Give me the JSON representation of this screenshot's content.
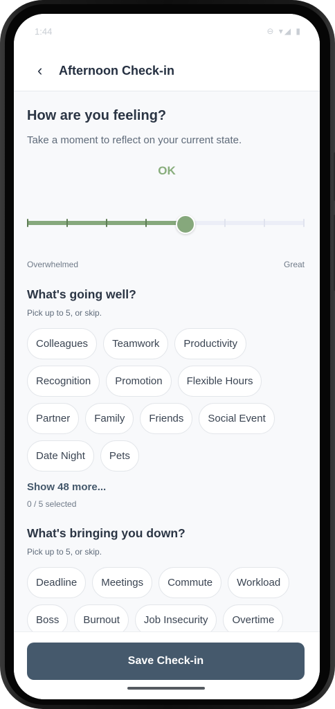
{
  "status_bar": {
    "time": "1:44",
    "icons": "⊖ ▾◢ ▮"
  },
  "header": {
    "back_icon": "chevron-left-icon",
    "back_glyph": "‹",
    "title": "Afternoon Check-in"
  },
  "feeling": {
    "title": "How are you feeling?",
    "subtitle": "Take a moment to reflect on your current state.",
    "mood_label": "OK",
    "slider": {
      "value_fraction": 0.57,
      "steps": 8,
      "min_label": "Overwhelmed",
      "max_label": "Great"
    }
  },
  "going_well": {
    "title": "What's going well?",
    "hint": "Pick up to 5, or skip.",
    "chip_rows": [
      [
        "Colleagues",
        "Teamwork",
        "Productivity"
      ],
      [
        "Recognition",
        "Promotion",
        "Flexible Hours"
      ],
      [
        "Partner",
        "Family",
        "Friends",
        "Social Event"
      ],
      [
        "Date Night",
        "Pets"
      ]
    ],
    "show_more": "Show 48 more...",
    "selected_count": "0 / 5 selected"
  },
  "bringing_down": {
    "title": "What's bringing you down?",
    "hint": "Pick up to 5, or skip.",
    "chip_rows": [
      [
        "Deadline",
        "Meetings",
        "Commute",
        "Workload"
      ],
      [
        "Boss",
        "Burnout",
        "Job Insecurity",
        "Overtime"
      ]
    ]
  },
  "footer": {
    "save_label": "Save Check-in"
  },
  "colors": {
    "accent_green": "#86a87c",
    "primary_button": "#45596c",
    "text_dark": "#2b3544"
  }
}
